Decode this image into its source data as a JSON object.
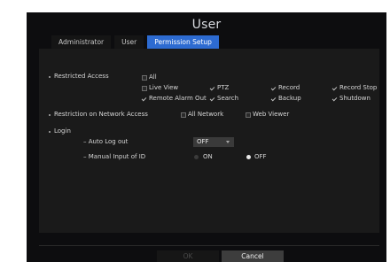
{
  "dialog": {
    "title": "User"
  },
  "tabs": [
    {
      "label": "Administrator",
      "active": false
    },
    {
      "label": "User",
      "active": false
    },
    {
      "label": "Permission Setup",
      "active": true
    }
  ],
  "restricted_access": {
    "label": "Restricted Access",
    "all_label": "All",
    "items": [
      {
        "label": "Live View",
        "checked": false
      },
      {
        "label": "PTZ",
        "checked": true
      },
      {
        "label": "Record",
        "checked": true
      },
      {
        "label": "Record Stop",
        "checked": true
      },
      {
        "label": "Remote Alarm Out",
        "checked": true
      },
      {
        "label": "Search",
        "checked": true
      },
      {
        "label": "Backup",
        "checked": true
      },
      {
        "label": "Shutdown",
        "checked": true
      }
    ]
  },
  "network_restriction": {
    "label": "Restriction on Network Access",
    "all_network_label": "All Network",
    "web_viewer_label": "Web Viewer"
  },
  "login": {
    "label": "Login",
    "auto_logout_label": "Auto Log out",
    "auto_logout_value": "OFF",
    "manual_input_label": "Manual Input of ID",
    "on_label": "ON",
    "off_label": "OFF",
    "selected": "OFF"
  },
  "buttons": {
    "ok": "OK",
    "cancel": "Cancel"
  },
  "colors": {
    "accent": "#2d6bd1",
    "background": "#0d0d0f",
    "panel": "#1a1a1a"
  }
}
